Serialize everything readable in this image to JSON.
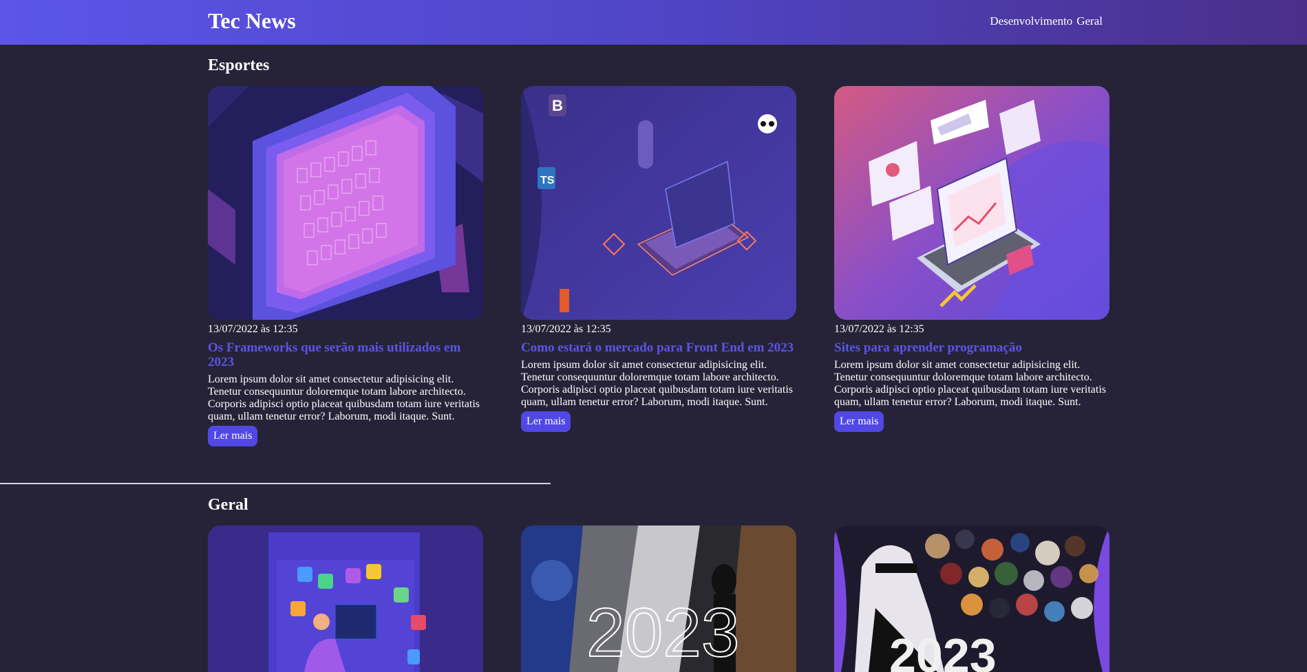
{
  "header": {
    "brand": "Tec News",
    "nav": [
      "Desenvolvimento",
      "Geral"
    ]
  },
  "sections": [
    {
      "title": "Esportes",
      "cards": [
        {
          "date": "13/07/2022 às 12:35",
          "title": "Os Frameworks que serão mais utilizados em 2023",
          "excerpt": "Lorem ipsum dolor sit amet consectetur adipisicing elit. Tenetur consequuntur doloremque totam labore architecto. Corporis adipisci optio placeat quibusdam totam iure veritatis quam, ullam tenetur error? Laborum, modi itaque. Sunt.",
          "button": "Ler mais"
        },
        {
          "date": "13/07/2022 às 12:35",
          "title": "Como estará o mercado para Front End em 2023",
          "excerpt": "Lorem ipsum dolor sit amet consectetur adipisicing elit. Tenetur consequuntur doloremque totam labore architecto. Corporis adipisci optio placeat quibusdam totam iure veritatis quam, ullam tenetur error? Laborum, modi itaque. Sunt.",
          "button": "Ler mais"
        },
        {
          "date": "13/07/2022 às 12:35",
          "title": "Sites para aprender programação",
          "excerpt": "Lorem ipsum dolor sit amet consectetur adipisicing elit. Tenetur consequuntur doloremque totam labore architecto. Corporis adipisci optio placeat quibusdam totam iure veritatis quam, ullam tenetur error? Laborum, modi itaque. Sunt.",
          "button": "Ler mais"
        }
      ]
    },
    {
      "title": "Geral",
      "image_texts": [
        "2023"
      ]
    }
  ],
  "colors": {
    "background": "#262338",
    "accent": "#5b55e8",
    "button": "#5048e5"
  }
}
